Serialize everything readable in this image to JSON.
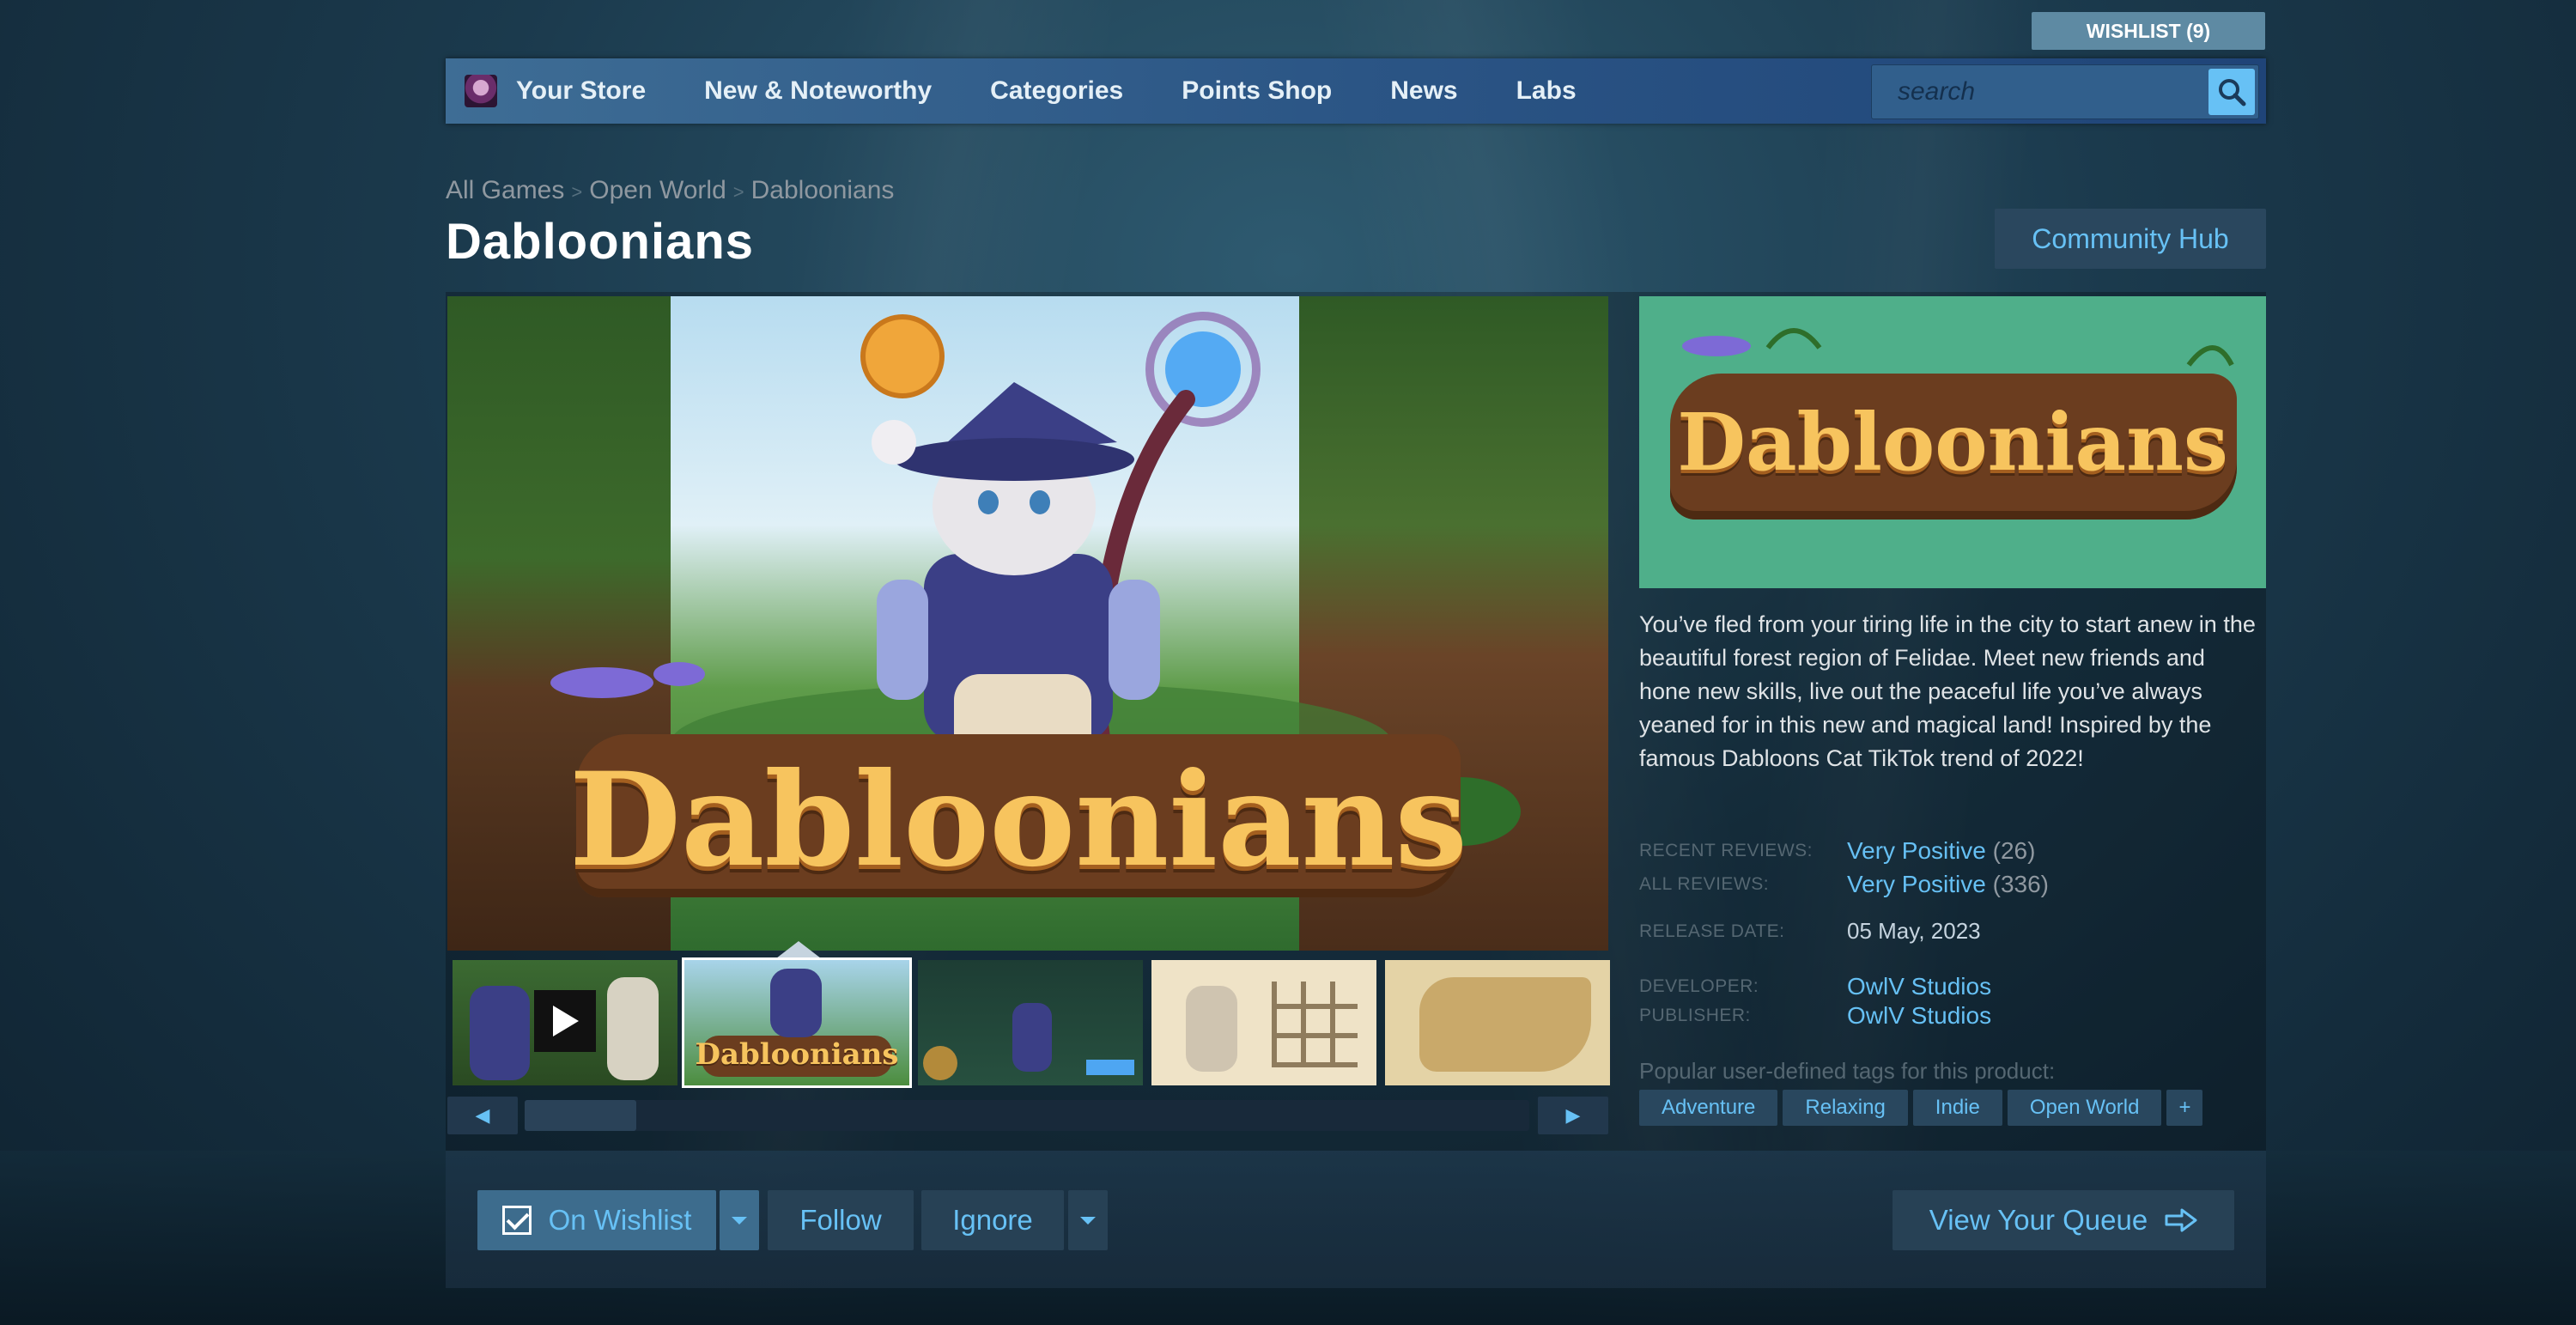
{
  "header": {
    "wishlist_label": "WISHLIST (9)",
    "nav_items": [
      "Your Store",
      "New & Noteworthy",
      "Categories",
      "Points Shop",
      "News",
      "Labs"
    ],
    "search_placeholder": "search"
  },
  "breadcrumb": [
    "All Games",
    "Open World",
    "Dabloonians"
  ],
  "title": "Dabloonians",
  "community_hub_label": "Community Hub",
  "hero": {
    "logo_text": "Dabloonians"
  },
  "capsule": {
    "logo_text": "Dabloonians"
  },
  "thumbnails": [
    {
      "kind": "video"
    },
    {
      "kind": "image",
      "active": true,
      "logo_text": "Dabloonians"
    },
    {
      "kind": "image"
    },
    {
      "kind": "image"
    },
    {
      "kind": "image"
    }
  ],
  "description": "You’ve fled from your tiring life in the city to start anew in the beautiful forest region of Felidae. Meet new friends and hone new skills, live out the peaceful life you’ve always yeaned for in this new and magical land! Inspired by the famous Dabloons Cat TikTok trend of 2022!",
  "reviews": {
    "recent_label": "RECENT REVIEWS:",
    "recent_value": "Very Positive",
    "recent_count": "(26)",
    "all_label": "ALL REVIEWS:",
    "all_value": "Very Positive",
    "all_count": "(336)"
  },
  "release": {
    "label": "RELEASE DATE:",
    "value": "05 May, 2023"
  },
  "developer": {
    "label": "DEVELOPER:",
    "value": "OwlV Studios"
  },
  "publisher": {
    "label": "PUBLISHER:",
    "value": "OwlV Studios"
  },
  "tags_label": "Popular user-defined tags for this product:",
  "tags": [
    "Adventure",
    "Relaxing",
    "Indie",
    "Open World",
    "+"
  ],
  "actions": {
    "wishlist": "On Wishlist",
    "follow": "Follow",
    "ignore": "Ignore",
    "queue": "View Your Queue"
  },
  "colors": {
    "accent": "#67c1f5",
    "nav_bg": "#2b5585",
    "capsule_bg": "#4faf8a"
  }
}
